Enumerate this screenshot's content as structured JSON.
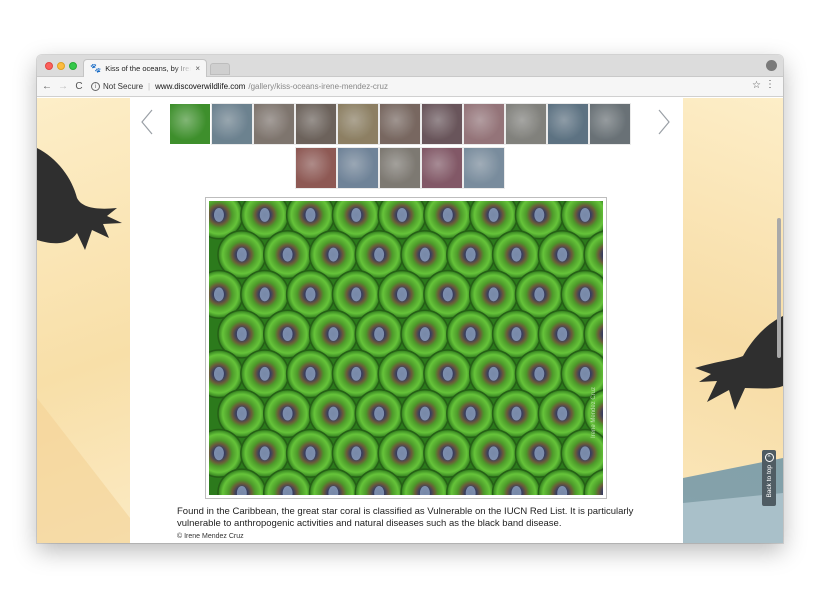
{
  "browser": {
    "tab_title": "Kiss of the oceans, by Irene M",
    "tab_favicon": "🐾",
    "tab_close": "×",
    "security_label": "Not Secure",
    "url_host": "www.discoverwildlife.com",
    "url_path": "/gallery/kiss-oceans-irene-mendez-cruz",
    "nav_back": "←",
    "nav_forward": "→",
    "nav_reload": "C",
    "star": "☆",
    "menu": "⋮",
    "profile": "●"
  },
  "gallery": {
    "thumbnails_row1": [
      {
        "color": "#3e8f2c",
        "active": true
      },
      {
        "color": "#6b8fa6",
        "active": false
      },
      {
        "color": "#8e7e72",
        "active": false
      },
      {
        "color": "#7a6a5e",
        "active": false
      },
      {
        "color": "#a08a5a",
        "active": false
      },
      {
        "color": "#8a6e62",
        "active": false
      },
      {
        "color": "#7b5a63",
        "active": false
      },
      {
        "color": "#b07a82",
        "active": false
      },
      {
        "color": "#8c8c84",
        "active": false
      },
      {
        "color": "#5a7e99",
        "active": false
      },
      {
        "color": "#6e7c84",
        "active": false
      }
    ],
    "thumbnails_row2": [
      {
        "color": "#b35a52",
        "active": false
      },
      {
        "color": "#6f90b3",
        "active": false
      },
      {
        "color": "#8a8377",
        "active": false
      },
      {
        "color": "#a05a72",
        "active": false
      },
      {
        "color": "#7a9ab6",
        "active": false
      }
    ],
    "prev_icon": "chevron-left-icon",
    "next_icon": "chevron-right-icon"
  },
  "photo": {
    "watermark": "Irene Mendez Cruz",
    "caption": "Found in the Caribbean, the great star coral is classified as Vulnerable on the IUCN Red List. It is particularly vulnerable to anthropogenic activities and natural diseases such as the black band disease.",
    "credit": "© Irene Mendez Cruz"
  },
  "back_to_top": {
    "label": "Back to top",
    "icon": "^"
  },
  "colors": {
    "accent_background": "#fbe8bf",
    "button_dark": "#4f5c63",
    "coral_green": "#3fa12a"
  }
}
